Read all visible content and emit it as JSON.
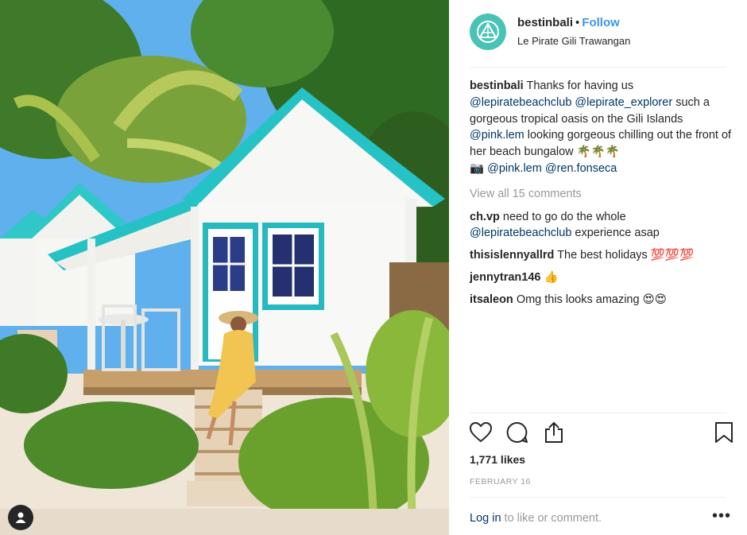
{
  "post": {
    "username": "bestinbali",
    "separator": "•",
    "follow_label": "Follow",
    "location": "Le Pirate Gili Trawangan"
  },
  "caption": {
    "username": "bestinbali",
    "text1": "Thanks for having us",
    "mention1": "@lepiratebeachclub",
    "mention2": "@lepirate_explorer",
    "text2": "such a gorgeous tropical oasis on the Gili Islands",
    "mention3": "@pink.lem",
    "text3": "looking gorgeous chilling out the front of her beach bungalow",
    "emojis1": "🌴🌴🌴",
    "camera": "📷",
    "mention4": "@pink.lem",
    "mention5": "@ren.fonseca"
  },
  "view_all": "View all 15 comments",
  "comments": [
    {
      "user": "ch.vp",
      "text": "need to go do the whole",
      "mention": "@lepiratebeachclub",
      "text_after": "experience asap"
    },
    {
      "user": "thisislennyallrd",
      "text": "The best holidays",
      "emoji": "💯💯💯"
    },
    {
      "user": "jennytran146",
      "text": "",
      "emoji": "👍"
    },
    {
      "user": "itsaleon",
      "text": "Omg this looks amazing",
      "emoji": "😍😍"
    }
  ],
  "actions": {
    "like_icon": "heart-icon",
    "comment_icon": "comment-bubble-icon",
    "share_icon": "share-icon",
    "save_icon": "bookmark-icon"
  },
  "likes": "1,771 likes",
  "date": "FEBRUARY 16",
  "footer": {
    "login_label": "Log in",
    "rest": "to like or comment.",
    "more": "•••"
  },
  "colors": {
    "accent": "#3897f0",
    "mention": "#003569",
    "muted": "#999999",
    "avatar": "#49c3b5"
  }
}
